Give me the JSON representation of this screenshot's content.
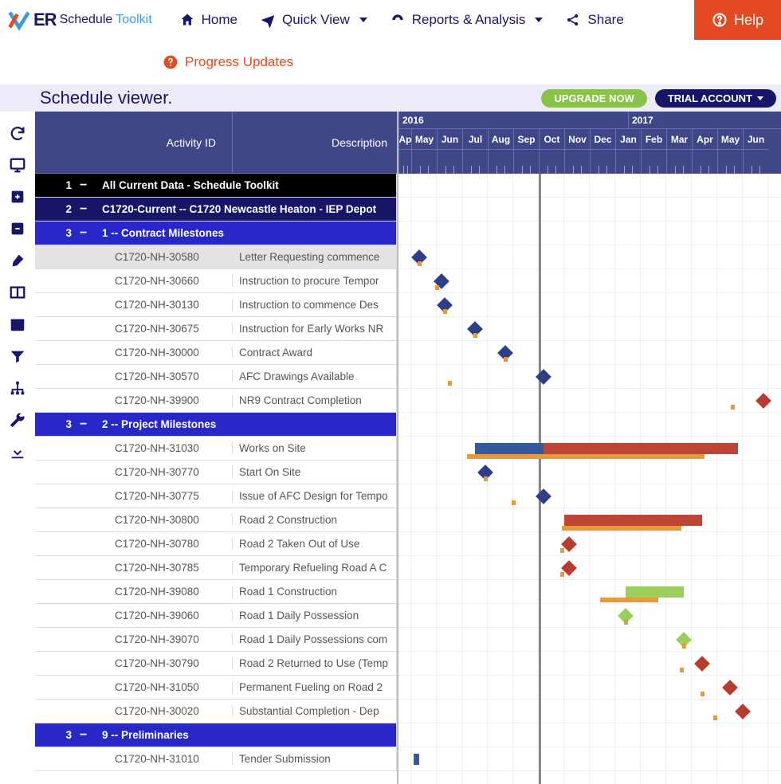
{
  "logo": {
    "brand": "ER",
    "word1": "Schedule",
    "word2": "Toolkit"
  },
  "nav": {
    "home": "Home",
    "quickview": "Quick View",
    "reports": "Reports & Analysis",
    "share": "Share",
    "help": "Help",
    "progress": "Progress Updates"
  },
  "subbar": {
    "title": "Schedule viewer.",
    "upgrade": "UPGRADE NOW",
    "trial": "TRIAL ACCOUNT"
  },
  "columns": {
    "id": "Activity ID",
    "desc": "Description"
  },
  "years": {
    "y2016": "2016",
    "y2017": "2017"
  },
  "months": [
    "Ap",
    "May",
    "Jun",
    "Jul",
    "Aug",
    "Sep",
    "Oct",
    "Nov",
    "Dec",
    "Jan",
    "Feb",
    "Mar",
    "Apr",
    "May",
    "Jun"
  ],
  "groups": {
    "g1": {
      "level": "1",
      "label": "All Current Data - Schedule Toolkit"
    },
    "g2": {
      "level": "2",
      "label": "C1720-Current -- C1720 Newcastle Heaton - IEP Depot"
    },
    "g3": {
      "level": "3",
      "label": "1 -- Contract Milestones"
    },
    "g4": {
      "level": "3",
      "label": "2 -- Project Milestones"
    },
    "g5": {
      "level": "3",
      "label": "9 -- Preliminaries"
    }
  },
  "rows": [
    {
      "id": "C1720-NH-30580",
      "desc": "Letter Requesting commence"
    },
    {
      "id": "C1720-NH-30660",
      "desc": "Instruction to procure Tempor"
    },
    {
      "id": "C1720-NH-30130",
      "desc": "Instruction to commence Des"
    },
    {
      "id": "C1720-NH-30675",
      "desc": "Instruction for Early Works NR"
    },
    {
      "id": "C1720-NH-30000",
      "desc": "Contract Award"
    },
    {
      "id": "C1720-NH-30570",
      "desc": "AFC Drawings Available"
    },
    {
      "id": "C1720-NH-39900",
      "desc": "NR9 Contract Completion"
    },
    {
      "id": "C1720-NH-31030",
      "desc": "Works on Site"
    },
    {
      "id": "C1720-NH-30770",
      "desc": "Start On Site"
    },
    {
      "id": "C1720-NH-30775",
      "desc": "Issue of AFC Design for Tempo"
    },
    {
      "id": "C1720-NH-30800",
      "desc": "Road 2 Construction"
    },
    {
      "id": "C1720-NH-30780",
      "desc": "Road 2 Taken Out of Use"
    },
    {
      "id": "C1720-NH-30785",
      "desc": "Temporary Refueling Road A C"
    },
    {
      "id": "C1720-NH-39080",
      "desc": "Road 1 Construction"
    },
    {
      "id": "C1720-NH-39060",
      "desc": "Road 1 Daily Possession"
    },
    {
      "id": "C1720-NH-39070",
      "desc": "Road 1 Daily Possessions com"
    },
    {
      "id": "C1720-NH-30790",
      "desc": "Road 2 Returned to Use (Temp"
    },
    {
      "id": "C1720-NH-31050",
      "desc": "Permanent Fueling on Road 2"
    },
    {
      "id": "C1720-NH-30020",
      "desc": "Substantial Completion - Dep"
    },
    {
      "id": "C1720-NH-31010",
      "desc": "Tender Submission"
    }
  ],
  "colors": {
    "navy": "#2d3e8a",
    "red": "#be4435",
    "green": "#9cce5a",
    "orange": "#e49a3a"
  },
  "chart_data": {
    "type": "bar",
    "title": "Schedule viewer.",
    "xlabel": "",
    "ylabel": "",
    "x_axis": {
      "years": [
        2016,
        2017
      ],
      "months": [
        "Apr",
        "May",
        "Jun",
        "Jul",
        "Aug",
        "Sep",
        "Oct",
        "Nov",
        "Dec",
        "Jan",
        "Feb",
        "Mar",
        "Apr",
        "May",
        "Jun"
      ],
      "status_line_month_index": 5
    },
    "rows": [
      {
        "id": "C1720-NH-30580",
        "planned": {
          "type": "milestone",
          "month_index": 0.3
        },
        "baseline": {
          "month_index": 0.3
        }
      },
      {
        "id": "C1720-NH-30660",
        "planned": {
          "type": "milestone",
          "month_index": 1.2
        },
        "baseline": {
          "month_index": 1.0
        }
      },
      {
        "id": "C1720-NH-30130",
        "planned": {
          "type": "milestone",
          "month_index": 1.3
        },
        "baseline": {
          "month_index": 1.3
        }
      },
      {
        "id": "C1720-NH-30675",
        "planned": {
          "type": "milestone",
          "month_index": 2.5
        },
        "baseline": {
          "month_index": 2.5
        }
      },
      {
        "id": "C1720-NH-30000",
        "planned": {
          "type": "milestone",
          "month_index": 3.7
        },
        "baseline": {
          "month_index": 3.7
        }
      },
      {
        "id": "C1720-NH-30570",
        "planned": {
          "type": "milestone",
          "month_index": 5.2
        },
        "baseline": {
          "month_index": 1.5
        }
      },
      {
        "id": "C1720-NH-39900",
        "planned": {
          "type": "milestone",
          "month_index": 13.8,
          "color": "red"
        },
        "baseline": {
          "month_index": 12.6
        }
      },
      {
        "id": "C1720-NH-31030",
        "planned": {
          "type": "bar",
          "start": 2.5,
          "end": 12.8,
          "progress_end": 5.2
        },
        "baseline": {
          "start": 2.2,
          "end": 11.5
        }
      },
      {
        "id": "C1720-NH-30770",
        "planned": {
          "type": "milestone",
          "month_index": 2.9
        },
        "baseline": {
          "month_index": 2.9
        }
      },
      {
        "id": "C1720-NH-30775",
        "planned": {
          "type": "milestone",
          "month_index": 5.2
        },
        "baseline": {
          "month_index": 4.0
        }
      },
      {
        "id": "C1720-NH-30800",
        "planned": {
          "type": "bar",
          "start": 6.0,
          "end": 11.4,
          "color": "red"
        },
        "baseline": {
          "start": 5.9,
          "end": 10.6
        }
      },
      {
        "id": "C1720-NH-30780",
        "planned": {
          "type": "milestone",
          "month_index": 6.2,
          "color": "red"
        },
        "baseline": {
          "month_index": 5.9
        }
      },
      {
        "id": "C1720-NH-30785",
        "planned": {
          "type": "milestone",
          "month_index": 6.2,
          "color": "red"
        },
        "baseline": {
          "month_index": 5.9
        }
      },
      {
        "id": "C1720-NH-39080",
        "planned": {
          "type": "bar",
          "start": 8.4,
          "end": 10.7,
          "color": "green"
        },
        "baseline": {
          "start": 7.4,
          "end": 9.7
        }
      },
      {
        "id": "C1720-NH-39060",
        "planned": {
          "type": "milestone",
          "month_index": 8.4,
          "color": "green"
        },
        "baseline": {
          "month_index": 8.4
        }
      },
      {
        "id": "C1720-NH-39070",
        "planned": {
          "type": "milestone",
          "month_index": 10.7,
          "color": "green"
        },
        "baseline": {
          "month_index": 10.7
        }
      },
      {
        "id": "C1720-NH-30790",
        "planned": {
          "type": "milestone",
          "month_index": 11.4,
          "color": "red"
        },
        "baseline": {
          "month_index": 10.6
        }
      },
      {
        "id": "C1720-NH-31050",
        "planned": {
          "type": "milestone",
          "month_index": 12.5,
          "color": "red"
        },
        "baseline": {
          "month_index": 11.4
        }
      },
      {
        "id": "C1720-NH-30020",
        "planned": {
          "type": "milestone",
          "month_index": 13.0,
          "color": "red"
        },
        "baseline": {
          "month_index": 11.9
        }
      },
      {
        "id": "C1720-NH-31010",
        "planned": {
          "type": "bar",
          "start": 0.1,
          "end": 0.3,
          "color": "navy"
        }
      }
    ]
  }
}
